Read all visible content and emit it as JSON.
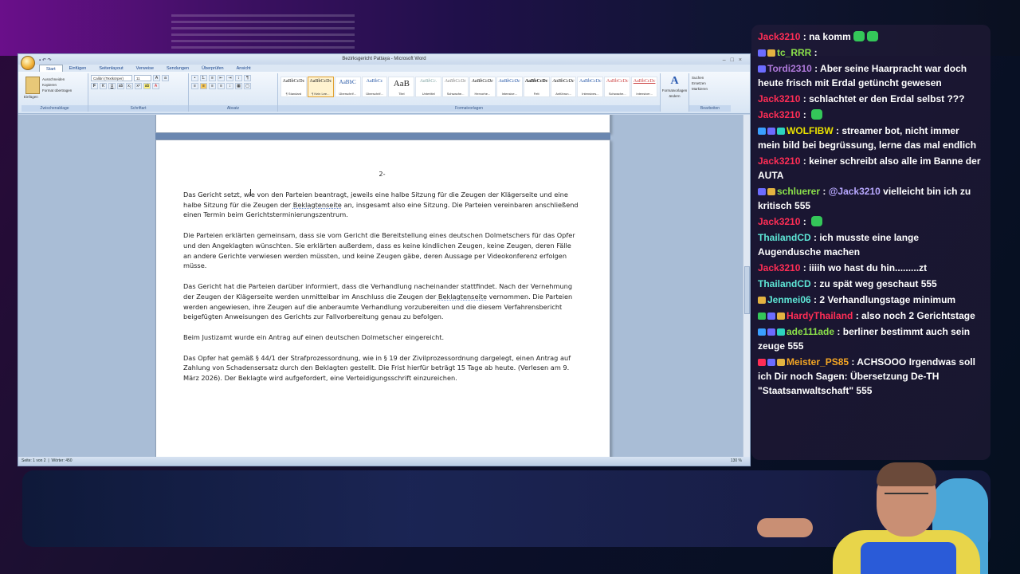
{
  "word": {
    "title": "Bezirksgericht Pattaya - Microsoft Word",
    "qat_icons": [
      "save-icon",
      "undo-icon",
      "redo-icon"
    ],
    "tabs": [
      "Start",
      "Einfügen",
      "Seitenlayout",
      "Verweise",
      "Sendungen",
      "Überprüfen",
      "Ansicht"
    ],
    "ribbon": {
      "clipboard": {
        "paste": "Einfügen",
        "cut": "Ausschneiden",
        "copy": "Kopieren",
        "format": "Format übertragen",
        "label": "Zwischenablage"
      },
      "font": {
        "family": "Calibri (Textkörper)",
        "size": "11",
        "label": "Schriftart"
      },
      "paragraph": {
        "label": "Absatz"
      },
      "styles": {
        "label": "Formatvorlagen",
        "items": [
          {
            "preview": "AaBbCcDc",
            "name": "¶ Standard"
          },
          {
            "preview": "AaBbCcDc",
            "name": "¶ Kein Lee...",
            "selected": true
          },
          {
            "preview": "AaBbC",
            "name": "Überschrif..."
          },
          {
            "preview": "AaBbCc",
            "name": "Überschrif..."
          },
          {
            "preview": "AaB",
            "name": "Titel"
          },
          {
            "preview": "AaBbCc.",
            "name": "Untertitel"
          },
          {
            "preview": "AaBbCcDc",
            "name": "Schwache..."
          },
          {
            "preview": "AaBbCcDc",
            "name": "Hervorhe..."
          },
          {
            "preview": "AaBbCcDc",
            "name": "Intensive..."
          },
          {
            "preview": "AaBbCcDc",
            "name": "Fett"
          },
          {
            "preview": "AaBbCcDc",
            "name": "Anführun..."
          },
          {
            "preview": "AaBbCcDc",
            "name": "Intensives..."
          },
          {
            "preview": "AaBbCcDc",
            "name": "Schwache..."
          },
          {
            "preview": "AaBbCcDc",
            "name": "Intensiver..."
          }
        ],
        "change": "Formatvorlagen ändern"
      },
      "editing": {
        "find": "Suchen",
        "replace": "Ersetzen",
        "select": "Markieren",
        "label": "Bearbeiten"
      }
    },
    "page_number": "2-",
    "paragraphs": {
      "p1_a": "Das Gericht setzt, wie von den Parteien beantragt, jeweils eine halbe Sitzung für die Zeugen der Klägerseite und eine halbe Sitzung für die Zeugen der ",
      "p1_u": "Beklagtenseite",
      "p1_b": " an, insgesamt also eine Sitzung. Die Parteien vereinbaren anschließend einen Termin beim Gerichtsterminierungszentrum.",
      "p2": "Die Parteien erklärten gemeinsam, dass sie vom Gericht die Bereitstellung eines deutschen Dolmetschers für das Opfer und den Angeklagten wünschten. Sie erklärten außerdem, dass es keine kindlichen Zeugen, keine Zeugen, deren Fälle an andere Gerichte verwiesen werden müssten, und keine Zeugen gäbe, deren Aussage per Videokonferenz erfolgen müsse.",
      "p3_a": "Das Gericht hat die Parteien darüber informiert, dass die Verhandlung nacheinander stattfindet. Nach der Vernehmung der Zeugen der Klägerseite werden unmittelbar im Anschluss die Zeugen der ",
      "p3_u": "Beklagtenseite",
      "p3_b": " vernommen. Die Parteien werden angewiesen, ihre Zeugen auf die anberaumte Verhandlung vorzubereiten und die diesem Verfahrensbericht beigefügten Anweisungen des Gerichts zur Fallvorbereitung genau zu befolgen.",
      "p4": "Beim Justizamt wurde ein Antrag auf einen deutschen Dolmetscher eingereicht.",
      "p5": "Das Opfer hat gemäß § 44/1 der Strafprozessordnung, wie in § 19 der Zivilprozessordnung dargelegt, einen Antrag auf Zahlung von Schadensersatz durch den Beklagten gestellt. Die Frist hierfür beträgt 15 Tage ab heute. (Verlesen am 9. März 2026). Der Beklagte wird aufgefordert, eine Verteidigungsschrift einzureichen."
    },
    "status": {
      "page": "Seite: 1 von 2",
      "words": "Wörter: 450",
      "zoom": "130 %"
    }
  },
  "chat": {
    "messages": [
      {
        "user": "Jack3210",
        "user_color": "#ff2d55",
        "text": "na komm",
        "emotes": 2
      },
      {
        "user": "tc_RRR",
        "user_color": "#8be04a",
        "text": "",
        "emotes": 0,
        "badges": [
          "#6c6cff",
          "#e3b341"
        ]
      },
      {
        "user": "Tordi2310",
        "user_color": "#b07adb",
        "text": "Aber seine Haarpracht war doch heute frisch mit Erdal getüncht gewesen",
        "badges": [
          "#6c6cff"
        ]
      },
      {
        "user": "Jack3210",
        "user_color": "#ff2d55",
        "text": "schlachtet er den Erdal selbst ???"
      },
      {
        "user": "Jack3210",
        "user_color": "#ff2d55",
        "text": "",
        "emotes": 1
      },
      {
        "user": "WOLFIBW",
        "user_color": "#e8e000",
        "text": "streamer bot, nicht immer mein bild bei begrüssung, lerne das mal endlich",
        "badges": [
          "#3aa0ff",
          "#6c6cff",
          "#2dd4bf"
        ]
      },
      {
        "user": "Jack3210",
        "user_color": "#ff2d55",
        "text": "keiner schreibt also alle im Banne der AUTA"
      },
      {
        "user": "schluerer",
        "user_color": "#8be04a",
        "text": "",
        "mention": "@Jack3210",
        "after": "vielleicht bin ich zu kritisch 555",
        "badges": [
          "#6c6cff",
          "#e3b341"
        ]
      },
      {
        "user": "Jack3210",
        "user_color": "#ff2d55",
        "text": "",
        "emotes": 1
      },
      {
        "user": "ThailandCD",
        "user_color": "#5ee6d6",
        "text": "ich musste eine lange Augendusche machen"
      },
      {
        "user": "Jack3210",
        "user_color": "#ff2d55",
        "text": "iiiih wo hast du hin.........zt"
      },
      {
        "user": "ThailandCD",
        "user_color": "#5ee6d6",
        "text": "zu spät weg geschaut 555"
      },
      {
        "user": "Jenmei06",
        "user_color": "#5ee6d6",
        "text": "2 Verhandlungstage minimum",
        "badges": [
          "#e3b341"
        ]
      },
      {
        "user": "HardyThailand",
        "user_color": "#ff2d55",
        "text": "also noch 2 Gerichtstage",
        "badges": [
          "#34c759",
          "#6c6cff",
          "#e3b341"
        ]
      },
      {
        "user": "ade111ade",
        "user_color": "#8be04a",
        "text": "berliner bestimmt auch sein zeuge 555",
        "badges": [
          "#3aa0ff",
          "#6c6cff",
          "#2dd4bf"
        ]
      },
      {
        "user": "Meister_PS85",
        "user_color": "#f5a623",
        "text": "ACHSOOO Irgendwas soll ich Dir noch Sagen: Übersetzung De-TH \"Staatsanwaltschaft\" 555",
        "badges": [
          "#ff2d55",
          "#6c6cff",
          "#e3b341"
        ]
      }
    ]
  }
}
